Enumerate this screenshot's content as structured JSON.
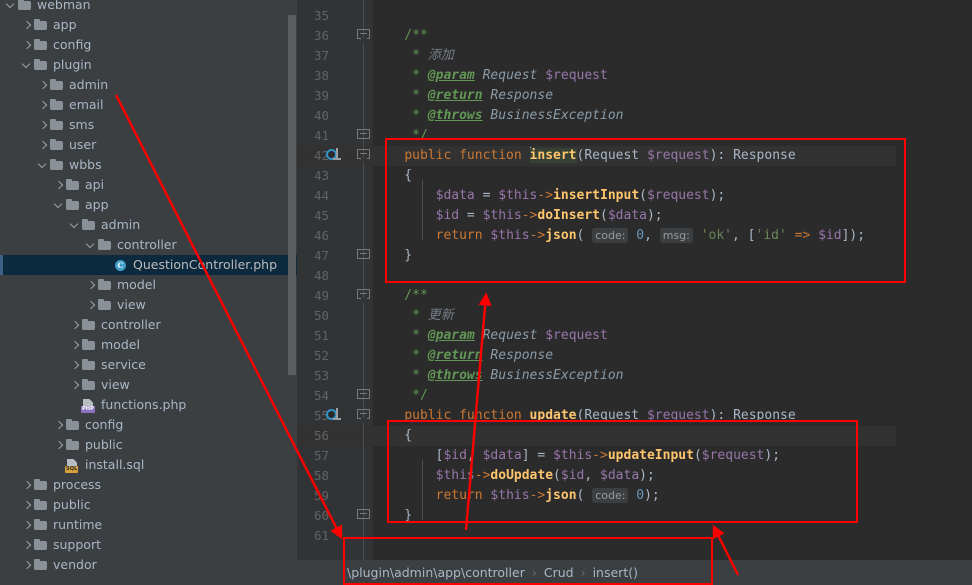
{
  "sidebar": {
    "scrollbar": "vertical-scrollbar",
    "items": [
      {
        "label": "webman",
        "depth": 0,
        "arrow": "down",
        "icon": "folder"
      },
      {
        "label": "app",
        "depth": 1,
        "arrow": "right",
        "icon": "folder"
      },
      {
        "label": "config",
        "depth": 1,
        "arrow": "right",
        "icon": "folder"
      },
      {
        "label": "plugin",
        "depth": 1,
        "arrow": "down",
        "icon": "folder"
      },
      {
        "label": "admin",
        "depth": 2,
        "arrow": "right",
        "icon": "folder"
      },
      {
        "label": "email",
        "depth": 2,
        "arrow": "right",
        "icon": "folder"
      },
      {
        "label": "sms",
        "depth": 2,
        "arrow": "right",
        "icon": "folder"
      },
      {
        "label": "user",
        "depth": 2,
        "arrow": "right",
        "icon": "folder"
      },
      {
        "label": "wbbs",
        "depth": 2,
        "arrow": "down",
        "icon": "folder"
      },
      {
        "label": "api",
        "depth": 3,
        "arrow": "right",
        "icon": "folder"
      },
      {
        "label": "app",
        "depth": 3,
        "arrow": "down",
        "icon": "folder"
      },
      {
        "label": "admin",
        "depth": 4,
        "arrow": "down",
        "icon": "folder"
      },
      {
        "label": "controller",
        "depth": 5,
        "arrow": "down",
        "icon": "folder"
      },
      {
        "label": "QuestionController.php",
        "depth": 6,
        "arrow": "none",
        "icon": "php-class",
        "selected": true
      },
      {
        "label": "model",
        "depth": 5,
        "arrow": "right",
        "icon": "folder"
      },
      {
        "label": "view",
        "depth": 5,
        "arrow": "right",
        "icon": "folder"
      },
      {
        "label": "controller",
        "depth": 4,
        "arrow": "right",
        "icon": "folder"
      },
      {
        "label": "model",
        "depth": 4,
        "arrow": "right",
        "icon": "folder"
      },
      {
        "label": "service",
        "depth": 4,
        "arrow": "right",
        "icon": "folder"
      },
      {
        "label": "view",
        "depth": 4,
        "arrow": "right",
        "icon": "folder"
      },
      {
        "label": "functions.php",
        "depth": 4,
        "arrow": "none",
        "icon": "php-file"
      },
      {
        "label": "config",
        "depth": 3,
        "arrow": "right",
        "icon": "folder"
      },
      {
        "label": "public",
        "depth": 3,
        "arrow": "right",
        "icon": "folder"
      },
      {
        "label": "install.sql",
        "depth": 3,
        "arrow": "none",
        "icon": "sql-file"
      },
      {
        "label": "process",
        "depth": 1,
        "arrow": "right",
        "icon": "folder"
      },
      {
        "label": "public",
        "depth": 1,
        "arrow": "right",
        "icon": "folder"
      },
      {
        "label": "runtime",
        "depth": 1,
        "arrow": "right",
        "icon": "folder"
      },
      {
        "label": "support",
        "depth": 1,
        "arrow": "right",
        "icon": "folder"
      },
      {
        "label": "vendor",
        "depth": 1,
        "arrow": "right",
        "icon": "folder"
      }
    ]
  },
  "editor": {
    "first_line_number": 35,
    "last_line_number": 61,
    "line_numbers": [
      35,
      36,
      37,
      38,
      39,
      40,
      41,
      42,
      43,
      44,
      45,
      46,
      47,
      48,
      49,
      50,
      51,
      52,
      53,
      54,
      55,
      56,
      57,
      58,
      59,
      60,
      61
    ],
    "gutter_icons": [
      {
        "line": 42,
        "name": "implementing-method-marker"
      },
      {
        "line": 55,
        "name": "implementing-method-marker"
      }
    ],
    "code_lines": [
      {
        "line": 35,
        "text": ""
      },
      {
        "line": 36,
        "text": "    /**"
      },
      {
        "line": 37,
        "text": "     * 添加"
      },
      {
        "line": 38,
        "text": "     * @param Request $request"
      },
      {
        "line": 39,
        "text": "     * @return Response"
      },
      {
        "line": 40,
        "text": "     * @throws BusinessException"
      },
      {
        "line": 41,
        "text": "     */"
      },
      {
        "line": 42,
        "text": "    public function insert(Request $request): Response"
      },
      {
        "line": 43,
        "text": "    {"
      },
      {
        "line": 44,
        "text": "        $data = $this->insertInput($request);"
      },
      {
        "line": 45,
        "text": "        $id = $this->doInsert($data);"
      },
      {
        "line": 46,
        "text": "        return $this->json( code: 0,  msg: 'ok', ['id' => $id]);"
      },
      {
        "line": 47,
        "text": "    }"
      },
      {
        "line": 48,
        "text": ""
      },
      {
        "line": 49,
        "text": "    /**"
      },
      {
        "line": 50,
        "text": "     * 更新"
      },
      {
        "line": 51,
        "text": "     * @param Request $request"
      },
      {
        "line": 52,
        "text": "     * @return Response"
      },
      {
        "line": 53,
        "text": "     * @throws BusinessException"
      },
      {
        "line": 54,
        "text": "     */"
      },
      {
        "line": 55,
        "text": "    public function update(Request $request): Response"
      },
      {
        "line": 56,
        "text": "    {"
      },
      {
        "line": 57,
        "text": "        [$id, $data] = $this->updateInput($request);"
      },
      {
        "line": 58,
        "text": "        $this->doUpdate($id, $data);"
      },
      {
        "line": 59,
        "text": "        return $this->json( code: 0);"
      },
      {
        "line": 60,
        "text": "    }"
      },
      {
        "line": 61,
        "text": ""
      }
    ],
    "parameter_hints": [
      "code:",
      "msg:"
    ],
    "selected_word": "insert"
  },
  "breadcrumb": {
    "namespace": "\\plugin\\admin\\app\\controller",
    "class": "Crud",
    "method": "insert()",
    "separator": "›"
  },
  "annotations": {
    "color": "#ff0000",
    "boxes": [
      {
        "name": "insert-method-highlight"
      },
      {
        "name": "update-method-highlight"
      },
      {
        "name": "breadcrumb-highlight"
      }
    ],
    "arrows": [
      {
        "name": "arrow-admin-to-breadcrumb"
      },
      {
        "name": "arrow-breadcrumb-to-update"
      },
      {
        "name": "arrow-update-to-insert"
      }
    ]
  }
}
